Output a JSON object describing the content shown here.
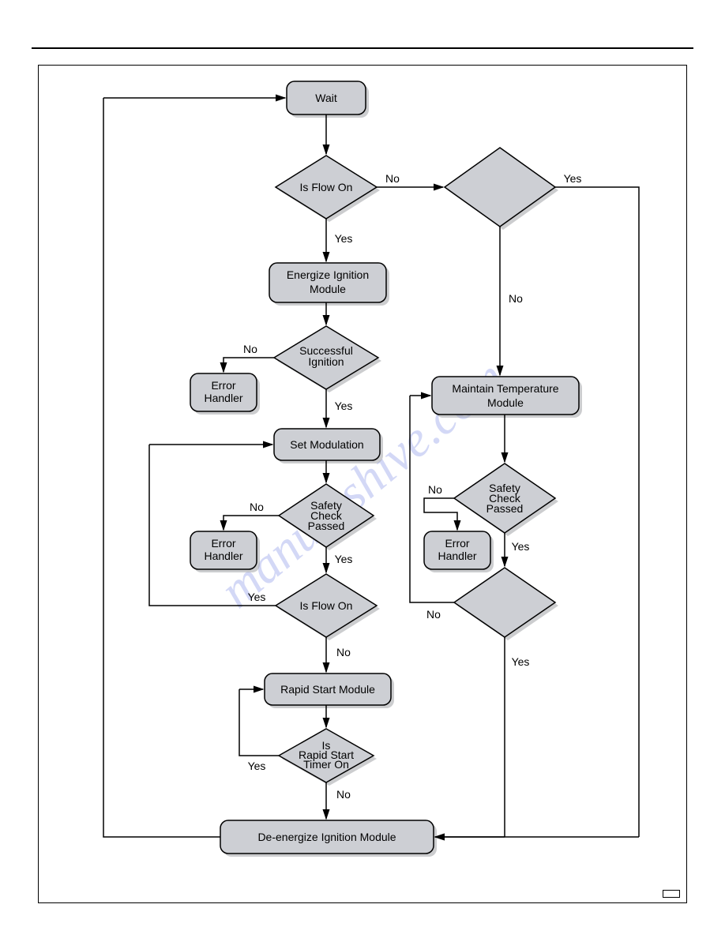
{
  "watermark": "manualshive.com",
  "page_number": " ",
  "nodes": {
    "wait": "Wait",
    "isflow1": "Is Flow On",
    "energize": "Energize Ignition\nModule",
    "succig": "Successful\nIgnition",
    "err1": "Error\nHandler",
    "setmod": "Set Modulation",
    "safety1": "Safety\nCheck\nPassed",
    "err2": "Error\nHandler",
    "isflow2": "Is Flow On",
    "rapid": "Rapid Start Module",
    "rapidtimer": "Is\nRapid Start\nTimer On",
    "deenergize": "De-energize Ignition Module",
    "blank1": "",
    "maintain": "Maintain Temperature\nModule",
    "safety2": "Safety\nCheck\nPassed",
    "err3": "Error\nHandler",
    "blank2": ""
  },
  "labels": {
    "yes": "Yes",
    "no": "No"
  }
}
